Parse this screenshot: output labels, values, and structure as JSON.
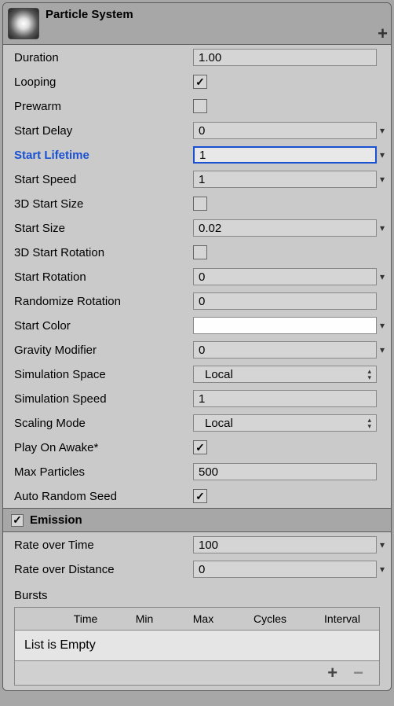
{
  "header": {
    "title": "Particle System"
  },
  "rows": {
    "duration": {
      "label": "Duration",
      "value": "1.00"
    },
    "looping": {
      "label": "Looping"
    },
    "prewarm": {
      "label": "Prewarm"
    },
    "start_delay": {
      "label": "Start Delay",
      "value": "0"
    },
    "start_lifetime": {
      "label": "Start Lifetime",
      "value": "1"
    },
    "start_speed": {
      "label": "Start Speed",
      "value": "1"
    },
    "start_size_3d": {
      "label": "3D Start Size"
    },
    "start_size": {
      "label": "Start Size",
      "value": "0.02"
    },
    "start_rot_3d": {
      "label": "3D Start Rotation"
    },
    "start_rotation": {
      "label": "Start Rotation",
      "value": "0"
    },
    "randomize_rotation": {
      "label": "Randomize Rotation",
      "value": "0"
    },
    "start_color": {
      "label": "Start Color",
      "value": "#ffffff"
    },
    "gravity_modifier": {
      "label": "Gravity Modifier",
      "value": "0"
    },
    "simulation_space": {
      "label": "Simulation Space",
      "value": "Local"
    },
    "simulation_speed": {
      "label": "Simulation Speed",
      "value": "1"
    },
    "scaling_mode": {
      "label": "Scaling Mode",
      "value": "Local"
    },
    "play_on_awake": {
      "label": "Play On Awake*"
    },
    "max_particles": {
      "label": "Max Particles",
      "value": "500"
    },
    "auto_random_seed": {
      "label": "Auto Random Seed"
    }
  },
  "emission": {
    "title": "Emission",
    "rate_over_time": {
      "label": "Rate over Time",
      "value": "100"
    },
    "rate_over_distance": {
      "label": "Rate over Distance",
      "value": "0"
    },
    "bursts": {
      "label": "Bursts",
      "columns": {
        "time": "Time",
        "min": "Min",
        "max": "Max",
        "cycles": "Cycles",
        "interval": "Interval"
      },
      "empty_text": "List is Empty"
    }
  }
}
